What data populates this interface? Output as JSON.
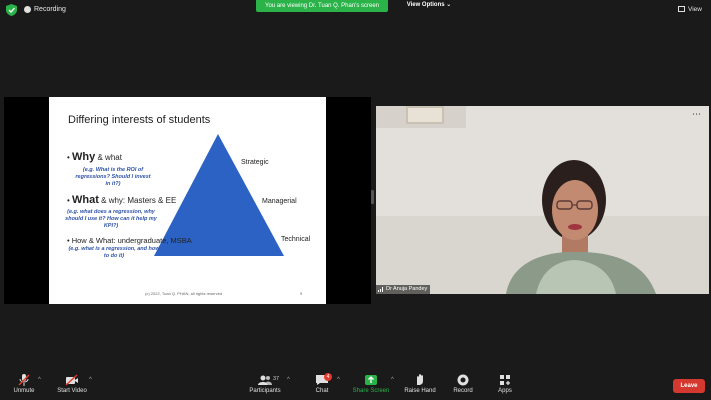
{
  "topbar": {
    "recording_label": "Recording",
    "viewing_banner": "You are viewing Dr. Tuan Q. Phan's screen",
    "view_options": "View Options",
    "view_label": "View"
  },
  "slide": {
    "title": "Differing interests of students",
    "levels": [
      "Strategic",
      "Managerial",
      "Technical"
    ],
    "bullets": [
      {
        "head": "Why",
        "rest": " & what",
        "sub": "(e.g. What is the ROI of regressions?  Should I invest in it?)"
      },
      {
        "head": "What",
        "rest": " & why: Masters & EE",
        "sub": "(e.g. what does a regression, why should I use it?  How can it help my KPI?)"
      },
      {
        "head": "How",
        "rest": " & What: undergraduate, MSBA",
        "sub": "(e.g. what is a regression, and how to do it)"
      }
    ],
    "footer": "(c) 2022, Tuan Q. PHAN, all rights reserved",
    "page_number": "9",
    "triangle_color": "#2c62c4"
  },
  "participant": {
    "name": "Dr Anuja Pandey"
  },
  "toolbar": {
    "unmute": "Unmute",
    "start_video": "Start Video",
    "participants": "Participants",
    "participants_count": "37",
    "chat": "Chat",
    "chat_badge": "4",
    "share_screen": "Share Screen",
    "raise_hand": "Raise Hand",
    "record": "Record",
    "apps": "Apps",
    "leave": "Leave",
    "share_color": "#2bb34a",
    "leave_color": "#d5382f"
  }
}
